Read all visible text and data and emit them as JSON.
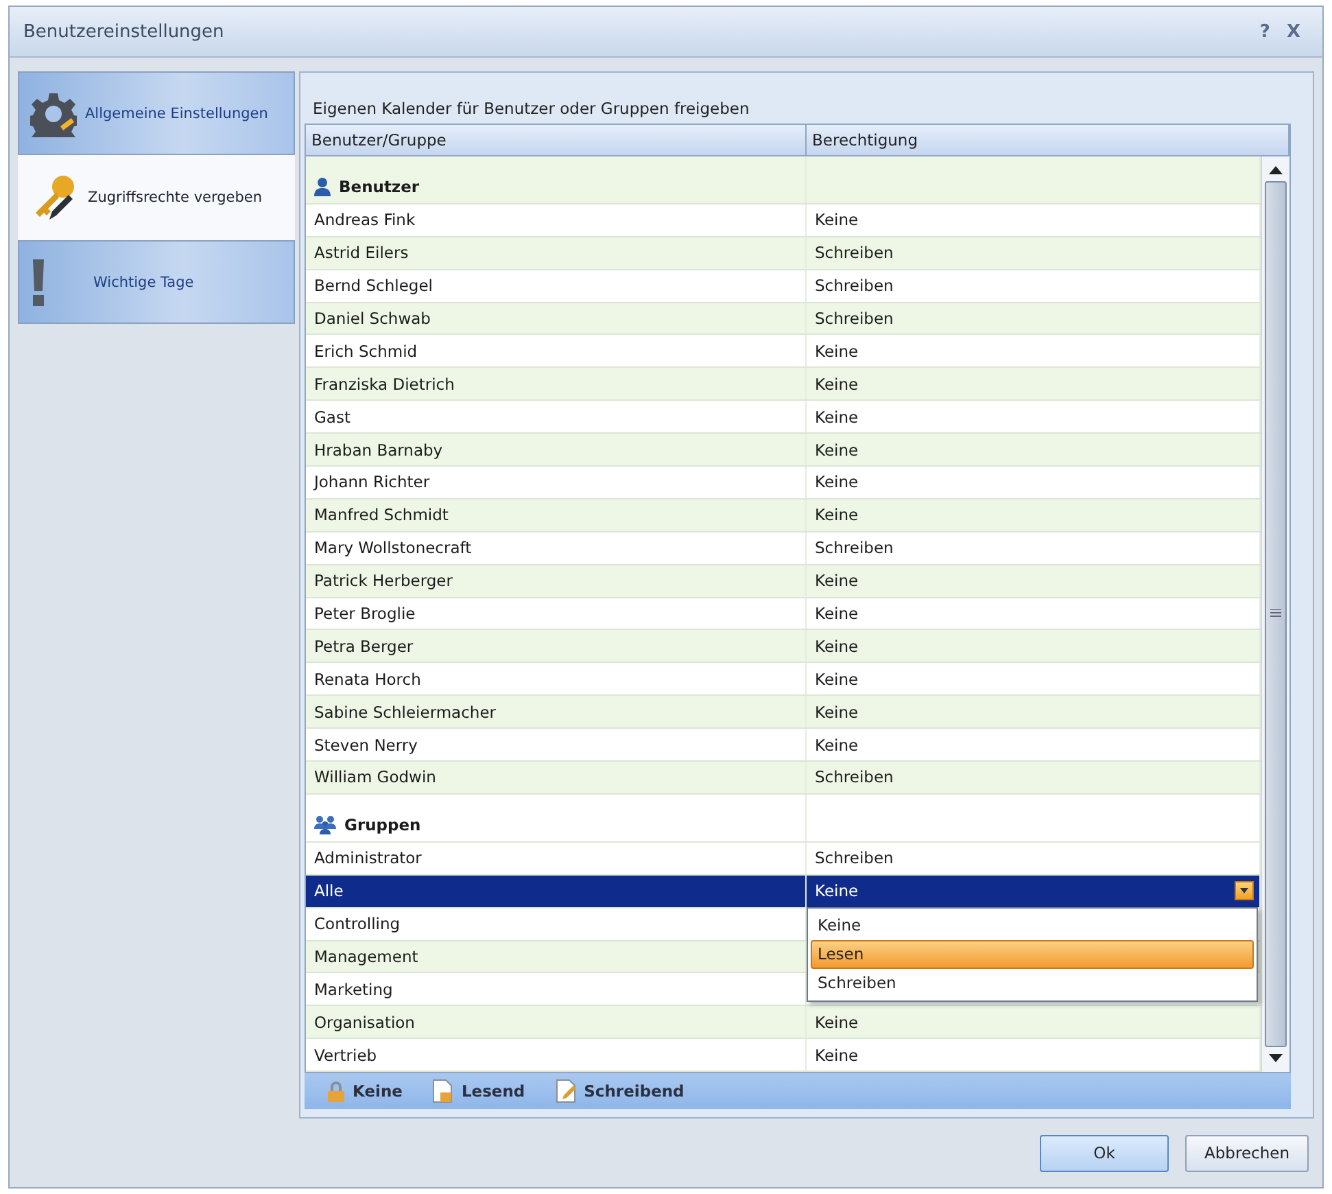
{
  "window": {
    "title": "Benutzereinstellungen",
    "controls": [
      "?",
      "X"
    ]
  },
  "sidebar": {
    "items": [
      {
        "label": "Allgemeine Einstellungen",
        "selected": false
      },
      {
        "label": "Zugriffsrechte vergeben",
        "selected": true
      },
      {
        "label": "Wichtige Tage",
        "selected": false
      }
    ]
  },
  "panel": {
    "heading": "Eigenen Kalender für Benutzer oder Gruppen freigeben"
  },
  "table": {
    "columns": [
      "Benutzer/Gruppe",
      "Berechtigung"
    ],
    "sections": [
      {
        "title": "Benutzer",
        "rows": [
          {
            "name": "Andreas Fink",
            "permission": "Keine",
            "selected": false
          },
          {
            "name": "Astrid Eilers",
            "permission": "Schreiben",
            "selected": false
          },
          {
            "name": "Bernd Schlegel",
            "permission": "Schreiben",
            "selected": false
          },
          {
            "name": "Daniel Schwab",
            "permission": "Schreiben",
            "selected": false
          },
          {
            "name": "Erich Schmid",
            "permission": "Keine",
            "selected": false
          },
          {
            "name": "Franziska Dietrich",
            "permission": "Keine",
            "selected": false
          },
          {
            "name": "Gast",
            "permission": "Keine",
            "selected": false
          },
          {
            "name": "Hraban Barnaby",
            "permission": "Keine",
            "selected": false
          },
          {
            "name": "Johann Richter",
            "permission": "Keine",
            "selected": false
          },
          {
            "name": "Manfred Schmidt",
            "permission": "Keine",
            "selected": false
          },
          {
            "name": "Mary Wollstonecraft",
            "permission": "Schreiben",
            "selected": false
          },
          {
            "name": "Patrick Herberger",
            "permission": "Keine",
            "selected": false
          },
          {
            "name": "Peter Broglie",
            "permission": "Keine",
            "selected": false
          },
          {
            "name": "Petra Berger",
            "permission": "Keine",
            "selected": false
          },
          {
            "name": "Renata Horch",
            "permission": "Keine",
            "selected": false
          },
          {
            "name": "Sabine Schleiermacher",
            "permission": "Keine",
            "selected": false
          },
          {
            "name": "Steven Nerry",
            "permission": "Keine",
            "selected": false
          },
          {
            "name": "William Godwin",
            "permission": "Schreiben",
            "selected": false
          }
        ]
      },
      {
        "title": "Gruppen",
        "rows": [
          {
            "name": "Administrator",
            "permission": "Schreiben",
            "selected": false
          },
          {
            "name": "Alle",
            "permission": "Keine",
            "selected": true,
            "dropdown": {
              "options": [
                {
                  "label": "Keine",
                  "selected": false
                },
                {
                  "label": "Lesen",
                  "selected": true
                },
                {
                  "label": "Schreiben",
                  "selected": false
                }
              ]
            }
          },
          {
            "name": "Controlling",
            "selected": false
          },
          {
            "name": "Management",
            "selected": false
          },
          {
            "name": "Marketing",
            "selected": false
          },
          {
            "name": "Organisation",
            "permission": "Keine",
            "selected": false
          },
          {
            "name": "Vertrieb",
            "permission": "Keine",
            "selected": false
          }
        ]
      }
    ]
  },
  "legend": [
    "Keine",
    "Lesend",
    "Schreibend"
  ],
  "buttons": [
    {
      "label": "Ok",
      "default": true
    },
    {
      "label": "Abbrechen",
      "default": false
    }
  ]
}
